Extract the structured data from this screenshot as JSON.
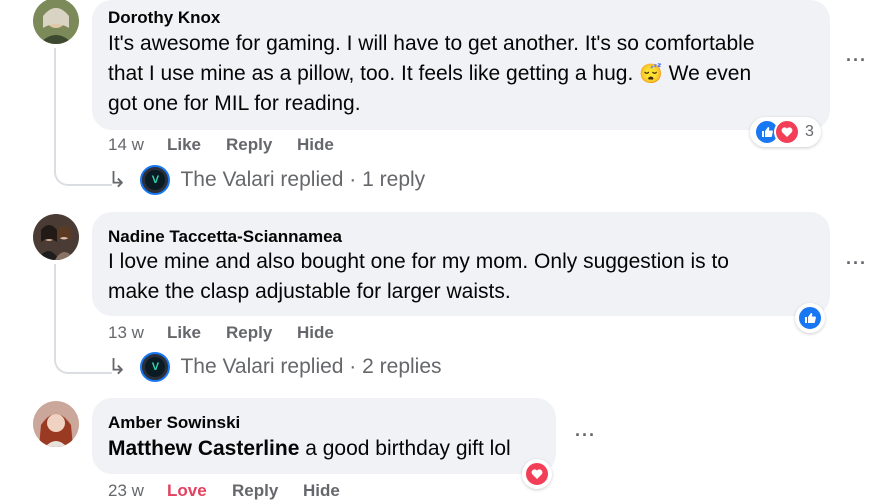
{
  "comments": [
    {
      "author": "Dorothy Knox",
      "lines": [
        "It's awesome for gaming. I will have to get another. It's so comfortable",
        "that I use mine as a pillow, too. It feels like getting a hug.",
        "got one for MIL for reading."
      ],
      "emoji_after_line2": "😴",
      "line2_tail": "We even",
      "time": "14 w",
      "like_label": "Like",
      "reply_label": "Reply",
      "hide_label": "Hide",
      "reaction_count": "3",
      "replied": "The Valari replied · 1 reply"
    },
    {
      "author": "Nadine Taccetta-Sciannamea",
      "lines": [
        "I love mine and also bought one for my mom. Only suggestion is to",
        "make the clasp adjustable for larger waists."
      ],
      "time": "13 w",
      "like_label": "Like",
      "reply_label": "Reply",
      "hide_label": "Hide",
      "replied": "The Valari replied · 2 replies"
    },
    {
      "author": "Amber Sowinski",
      "mention": "Matthew Casterline",
      "text": " a good birthday gift lol",
      "time": "23 w",
      "like_label": "Love",
      "reply_label": "Reply",
      "hide_label": "Hide"
    }
  ],
  "more_label": "···",
  "colors": {
    "bubble": "#f0f2f5",
    "meta": "#65676b",
    "like_blue": "#1877f2",
    "love_red": "#f33e58"
  }
}
